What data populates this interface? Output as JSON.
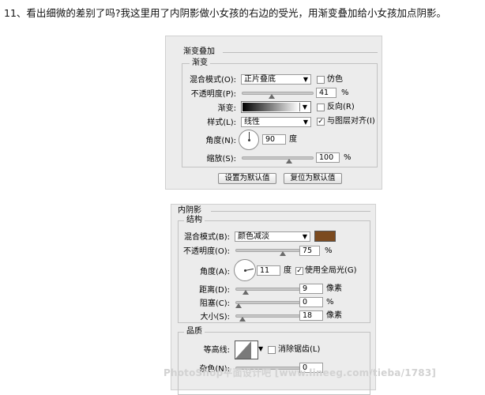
{
  "caption": "11、看出细微的差别了吗?我这里用了内阴影做小女孩的右边的受光，用渐变叠加给小女孩加点阴影。",
  "gradient_overlay": {
    "title": "渐变叠加",
    "group_title": "渐变",
    "blend_mode_label": "混合模式(O):",
    "blend_mode_value": "正片叠底",
    "dither_label": "仿色",
    "opacity_label": "不透明度(P):",
    "opacity_value": "41",
    "opacity_level": 0.41,
    "percent": "%",
    "gradient_label": "渐变:",
    "reverse_label": "反向(R)",
    "style_label": "样式(L):",
    "style_value": "线性",
    "align_label": "与图层对齐(I)",
    "align_checked": true,
    "angle_label": "角度(N):",
    "angle_value": "90",
    "angle_unit": "度",
    "scale_label": "缩放(S):",
    "scale_value": "100",
    "scale_level": 0.67,
    "default_button": "设置为默认值",
    "reset_button": "复位为默认值"
  },
  "inner_shadow": {
    "title": "内阴影",
    "structure_title": "结构",
    "blend_mode_label": "混合模式(B):",
    "blend_mode_value": "颜色减淡",
    "swatch_color": "#7b4a1f",
    "opacity_label": "不透明度(O):",
    "opacity_value": "75",
    "opacity_level": 0.75,
    "percent": "%",
    "angle_label": "角度(A):",
    "angle_value": "11",
    "angle_unit": "度",
    "global_light_label": "使用全局光(G)",
    "global_light_checked": true,
    "distance_label": "距离(D):",
    "distance_value": "9",
    "pixels": "像素",
    "choke_label": "阻塞(C):",
    "choke_value": "0",
    "choke_level": 0.0,
    "size_label": "大小(S):",
    "size_value": "18",
    "size_level": 0.07,
    "quality_title": "品质",
    "contour_label": "等高线:",
    "antialias_label": "消除锯齿(L)",
    "noise_label": "杂色(N):",
    "noise_value": "0"
  },
  "watermark": "PhotoShop平面设计吧 [www.lineeg.com/tieba/1783]"
}
